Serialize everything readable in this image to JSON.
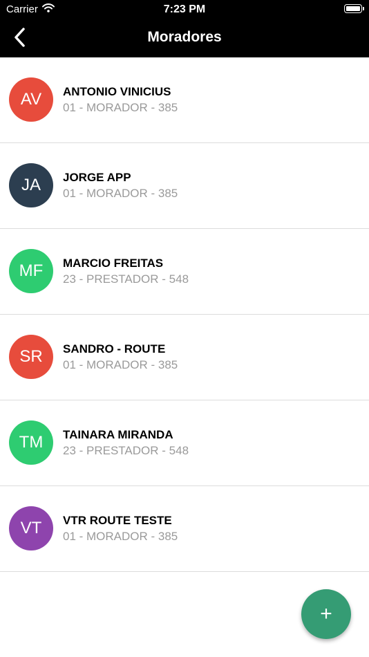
{
  "status_bar": {
    "carrier": "Carrier",
    "time": "7:23 PM",
    "wifi_icon": "wifi-icon",
    "battery_icon": "battery-icon"
  },
  "nav": {
    "title": "Moradores",
    "back_icon": "chevron-left-icon"
  },
  "residents": [
    {
      "initials": "AV",
      "name": "ANTONIO VINICIUS",
      "subtitle": "01 - MORADOR - 385",
      "color": "#e74c3c"
    },
    {
      "initials": "JA",
      "name": "JORGE APP",
      "subtitle": "01 - MORADOR - 385",
      "color": "#2c3e50"
    },
    {
      "initials": "MF",
      "name": "MARCIO FREITAS",
      "subtitle": "23 - PRESTADOR - 548",
      "color": "#2ecc71"
    },
    {
      "initials": "SR",
      "name": "SANDRO - ROUTE",
      "subtitle": "01 - MORADOR - 385",
      "color": "#e74c3c"
    },
    {
      "initials": "TM",
      "name": "TAINARA MIRANDA",
      "subtitle": "23 - PRESTADOR - 548",
      "color": "#2ecc71"
    },
    {
      "initials": "VT",
      "name": "VTR ROUTE TESTE",
      "subtitle": "01 - MORADOR - 385",
      "color": "#8e44ad"
    }
  ],
  "fab": {
    "label": "+",
    "color": "#359c74",
    "icon": "plus-icon"
  }
}
